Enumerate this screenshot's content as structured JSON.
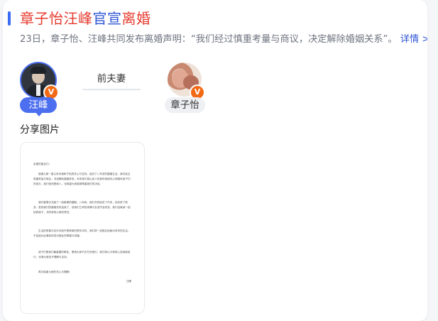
{
  "card": {
    "title_parts": [
      "章子怡汪峰",
      "官宣",
      "离婚"
    ],
    "description": "23日，章子怡、汪峰共同发布离婚声明：“我们经过慎重考量与商议，决定解除婚姻关系”。",
    "more_link": "详情 >"
  },
  "relation": {
    "left_person": {
      "name": "汪峰",
      "badge": "V",
      "icon": "verified-v-icon"
    },
    "right_person": {
      "name": "章子怡",
      "badge": "V",
      "icon": "verified-v-icon"
    },
    "label": "前夫妻"
  },
  "images_section": {
    "title": "分享图片",
    "document": {
      "greeting": "亲爱的朋友们：",
      "paragraphs": [
        "感谢大家一直以来对我和子怡的关心与支持。经历了八年多的婚姻生活，我们经过慎重考量与商议，决定解除婚姻关系。未来我们将以亲人的身份继续关心和陪伴孩子们的成长，我们依然是家人，也希望大家能够尊重我们的决定。",
        "我们曾携手共度了一段美满的婚姻，八年间，我们共同经历了许多，也收获了很多。虽然我们的婚姻关系结束了，但我们之间的亲情与友谊不会改变，我们会继续一起抚养孩子，共同承担父母的责任。",
        "生活的悲喜与苦乐本就不是简单的是非评判，我们将一如既往地面对未来的生活，不会因为此事而改变对彼此的尊重与祝福。",
        "孩子们是我们最重要的牵挂，恳请大家不去打扰他们，我们将以平和的心态继续前行，也请大家给予理解与支持。",
        "再次感谢大家的关心与理解！"
      ],
      "signature": "汪峰"
    }
  },
  "colors": {
    "accent_blue": "#2e55d4",
    "title_red": "#e63a2e",
    "badge_orange": "#f26a15",
    "tag_blue": "#4c6ff0"
  }
}
